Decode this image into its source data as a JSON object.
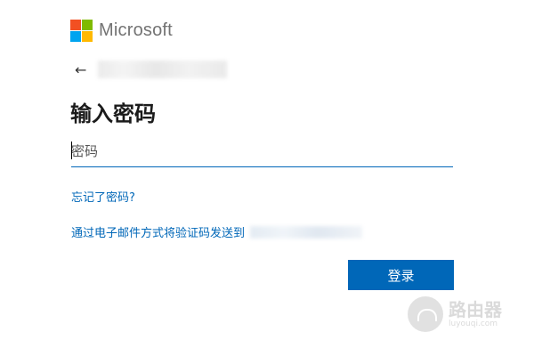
{
  "header": {
    "brand_name": "Microsoft",
    "logo_colors": [
      "#f25022",
      "#7fba00",
      "#00a4ef",
      "#ffb900"
    ]
  },
  "account": {
    "back_icon": "back-arrow-icon"
  },
  "page": {
    "title": "输入密码"
  },
  "password": {
    "placeholder": "密码",
    "value": ""
  },
  "links": {
    "forgot_password": "忘记了密码?",
    "email_code": "通过电子邮件方式将验证码发送到"
  },
  "actions": {
    "sign_in": "登录"
  },
  "watermark": {
    "name": "路由器",
    "url": "luyouqi.com"
  },
  "colors": {
    "accent": "#0067b8",
    "brand_text": "#737373"
  }
}
